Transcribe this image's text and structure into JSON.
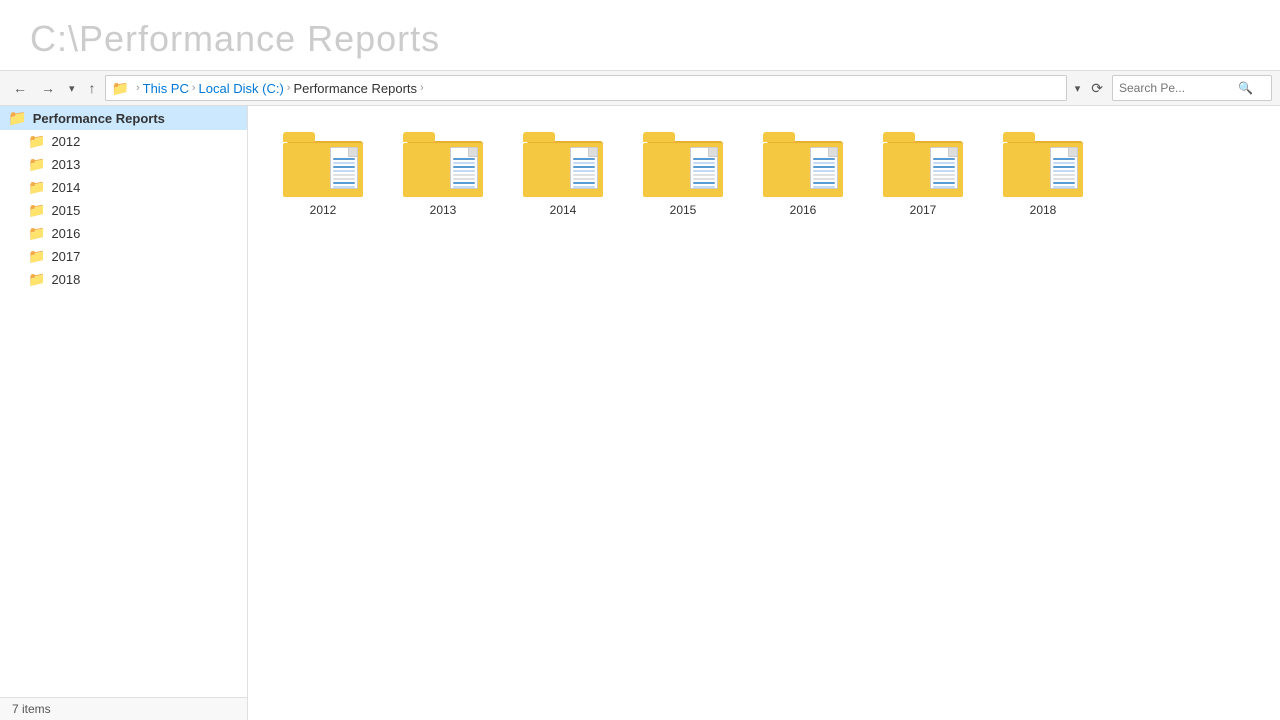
{
  "title": {
    "prefix": "C:\\",
    "name": "Performance Reports"
  },
  "addressbar": {
    "back_label": "←",
    "forward_label": "→",
    "dropdown_label": "▾",
    "up_label": "↑",
    "this_pc": "This PC",
    "local_disk": "Local Disk (C:)",
    "folder": "Performance Reports",
    "search_placeholder": "Search Pe...",
    "refresh_label": "⟳",
    "dropdown2_label": "▾"
  },
  "sidebar": {
    "parent_label": "Performance Reports",
    "items": [
      {
        "label": "2012"
      },
      {
        "label": "2013"
      },
      {
        "label": "2014"
      },
      {
        "label": "2015"
      },
      {
        "label": "2016"
      },
      {
        "label": "2017"
      },
      {
        "label": "2018"
      }
    ]
  },
  "status": {
    "count_label": "7 items"
  },
  "folders": [
    {
      "label": "2012"
    },
    {
      "label": "2013"
    },
    {
      "label": "2014"
    },
    {
      "label": "2015"
    },
    {
      "label": "2016"
    },
    {
      "label": "2017"
    },
    {
      "label": "2018"
    }
  ]
}
